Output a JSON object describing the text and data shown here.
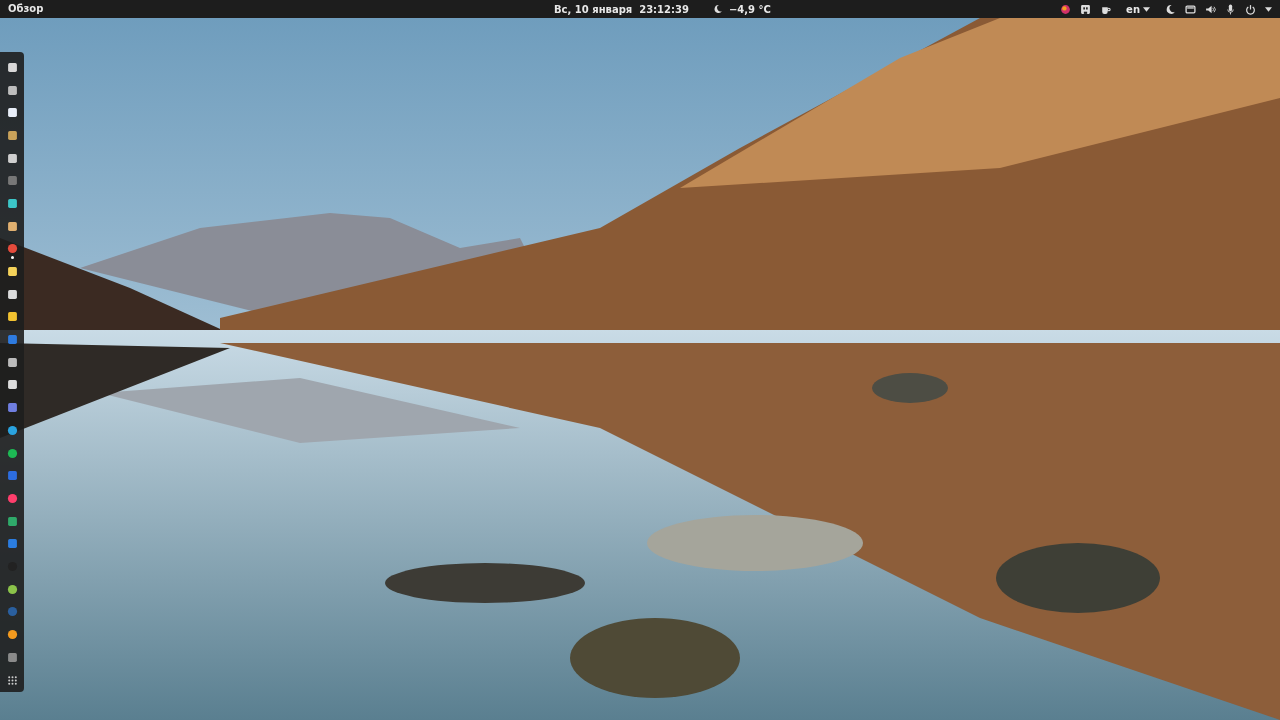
{
  "top_bar": {
    "activities": "Обзор",
    "date": "Вс, 10 января",
    "time": "23:12:39",
    "weather": "−4,9 °C",
    "language": "en"
  },
  "dock": {
    "apps": [
      {
        "running": false
      },
      {
        "running": false
      },
      {
        "running": false
      },
      {
        "running": false
      },
      {
        "running": false
      },
      {
        "running": false
      },
      {
        "running": false
      },
      {
        "running": false
      },
      {
        "running": true
      },
      {
        "running": false
      },
      {
        "running": false
      },
      {
        "running": false
      },
      {
        "running": false
      },
      {
        "running": false
      },
      {
        "running": false
      },
      {
        "running": false
      },
      {
        "running": false
      },
      {
        "running": false
      },
      {
        "running": false
      },
      {
        "running": false
      },
      {
        "running": false
      },
      {
        "running": false
      },
      {
        "running": false
      },
      {
        "running": false
      },
      {
        "running": false
      },
      {
        "running": false
      },
      {
        "running": false
      }
    ]
  }
}
